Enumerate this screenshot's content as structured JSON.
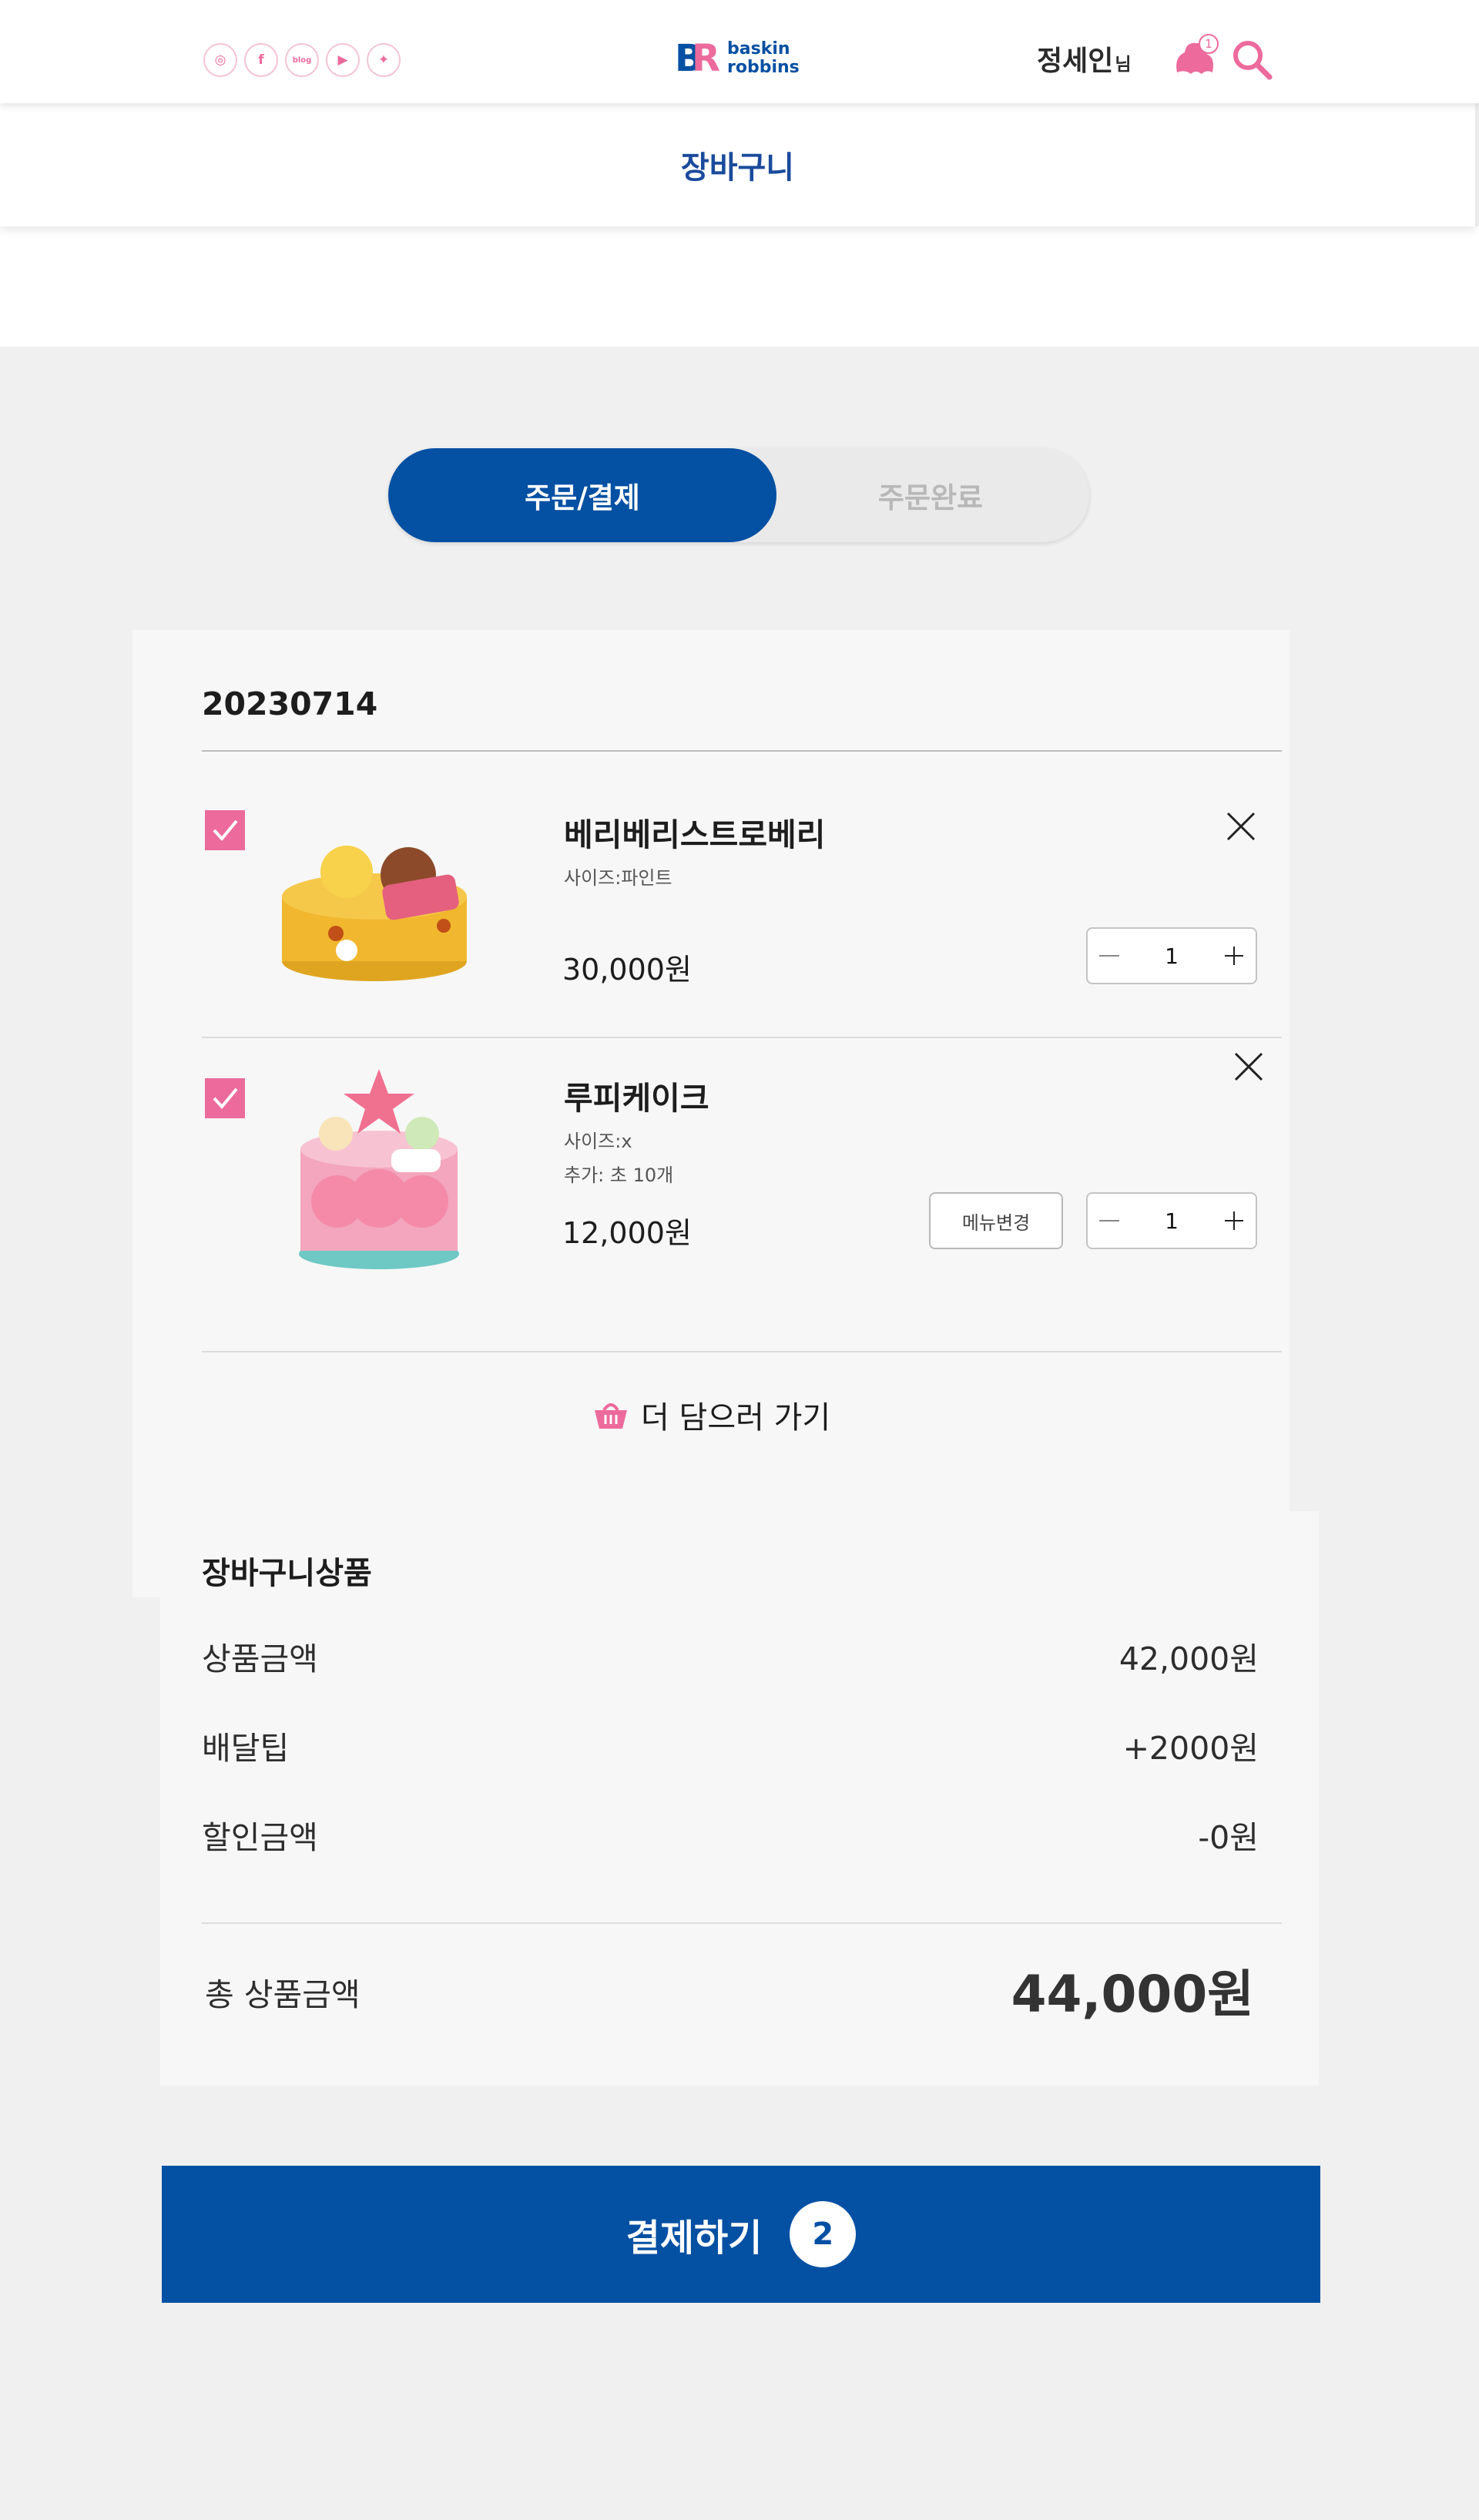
{
  "header": {
    "sns": [
      {
        "name": "instagram-icon",
        "glyph": "◎"
      },
      {
        "name": "facebook-icon",
        "glyph": "f"
      },
      {
        "name": "blog-icon",
        "glyph": "blog"
      },
      {
        "name": "youtube-icon",
        "glyph": "▶"
      },
      {
        "name": "twitter-icon",
        "glyph": "✦"
      }
    ],
    "user_name": "정세인",
    "user_suffix": "님",
    "notification_count": "1",
    "page_title": "장바구니"
  },
  "steps": {
    "active_label": "주문/결제",
    "inactive_label": "주문완료"
  },
  "order": {
    "date": "20230714",
    "items": [
      {
        "name": "베리베리스트로베리",
        "options": [
          "사이즈:파인트"
        ],
        "price": "30,000원",
        "quantity": "1",
        "checked": true
      },
      {
        "name": "루피케이크",
        "options": [
          "사이즈:x",
          "추가: 초 10개"
        ],
        "price": "12,000원",
        "quantity": "1",
        "checked": true,
        "menu_change_label": "메뉴변경"
      }
    ],
    "add_more_label": "더 담으러 가기"
  },
  "summary": {
    "title": "장바구니상품",
    "rows": [
      {
        "label": "상품금액",
        "value": "42,000원"
      },
      {
        "label": "배달팁",
        "value": "+2000원"
      },
      {
        "label": "할인금액",
        "value": "-0원"
      }
    ],
    "total_label": "총 상품금액",
    "total_value": "44,000원"
  },
  "pay": {
    "label": "결제하기",
    "count": "2"
  },
  "colors": {
    "brand_blue": "#0450a3",
    "brand_pink": "#ec6a9c",
    "panel_bg": "#f7f7f7",
    "page_bg": "#f0f0f0"
  }
}
